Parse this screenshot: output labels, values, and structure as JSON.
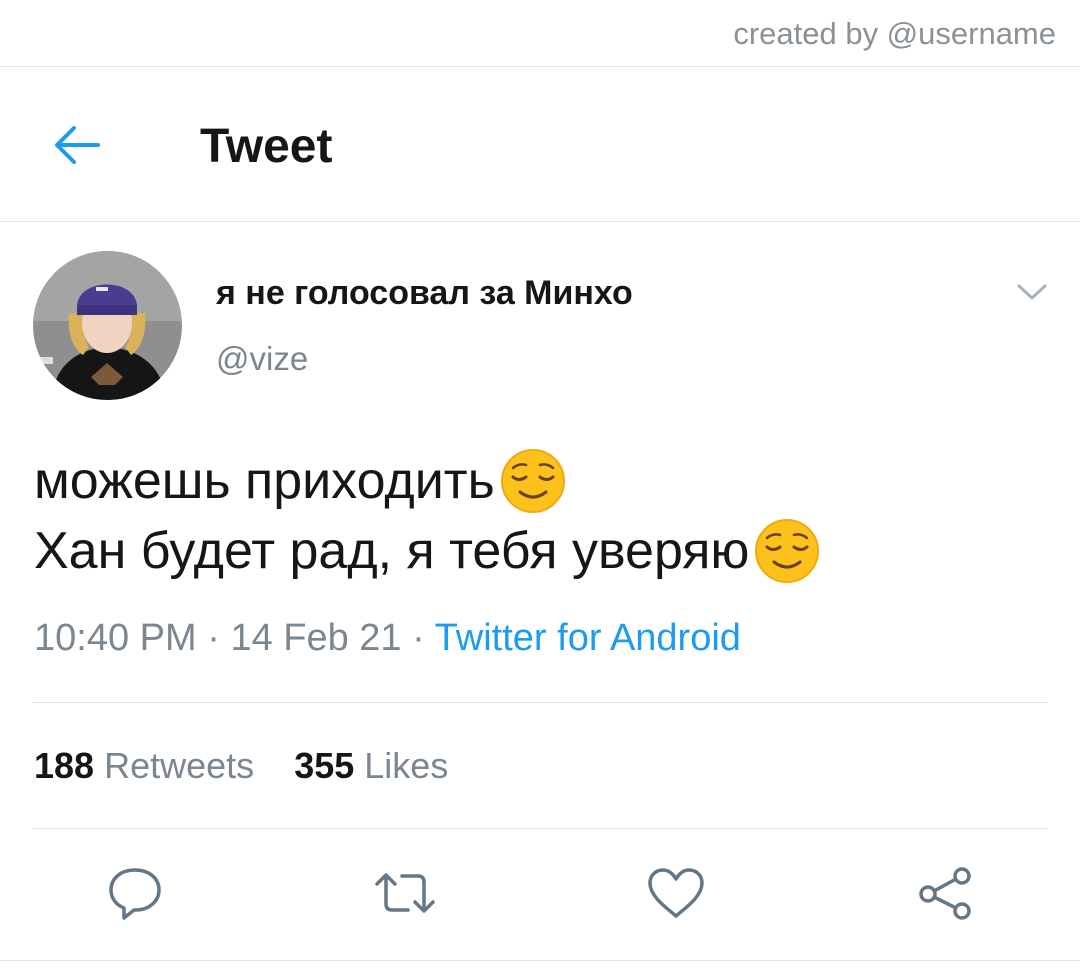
{
  "watermark": {
    "text": "created by @username"
  },
  "header": {
    "back_icon": "arrow-left-icon",
    "title": "Tweet",
    "accent_color": "#1d9bf0"
  },
  "tweet": {
    "author": {
      "display_name": "я не голосовал за Минхо",
      "handle": "@vize"
    },
    "lines": [
      "можешь приходить",
      "Хан будет рад, я тебя уверяю"
    ],
    "emoji": "relieved-face",
    "time": "10:40 PM",
    "date": "14 Feb 21",
    "source": "Twitter for Android",
    "separator": "·"
  },
  "stats": {
    "retweets_count": "188",
    "retweets_label": "Retweets",
    "likes_count": "355",
    "likes_label": "Likes"
  },
  "actions": [
    "reply-icon",
    "retweet-icon",
    "like-icon",
    "share-icon"
  ]
}
